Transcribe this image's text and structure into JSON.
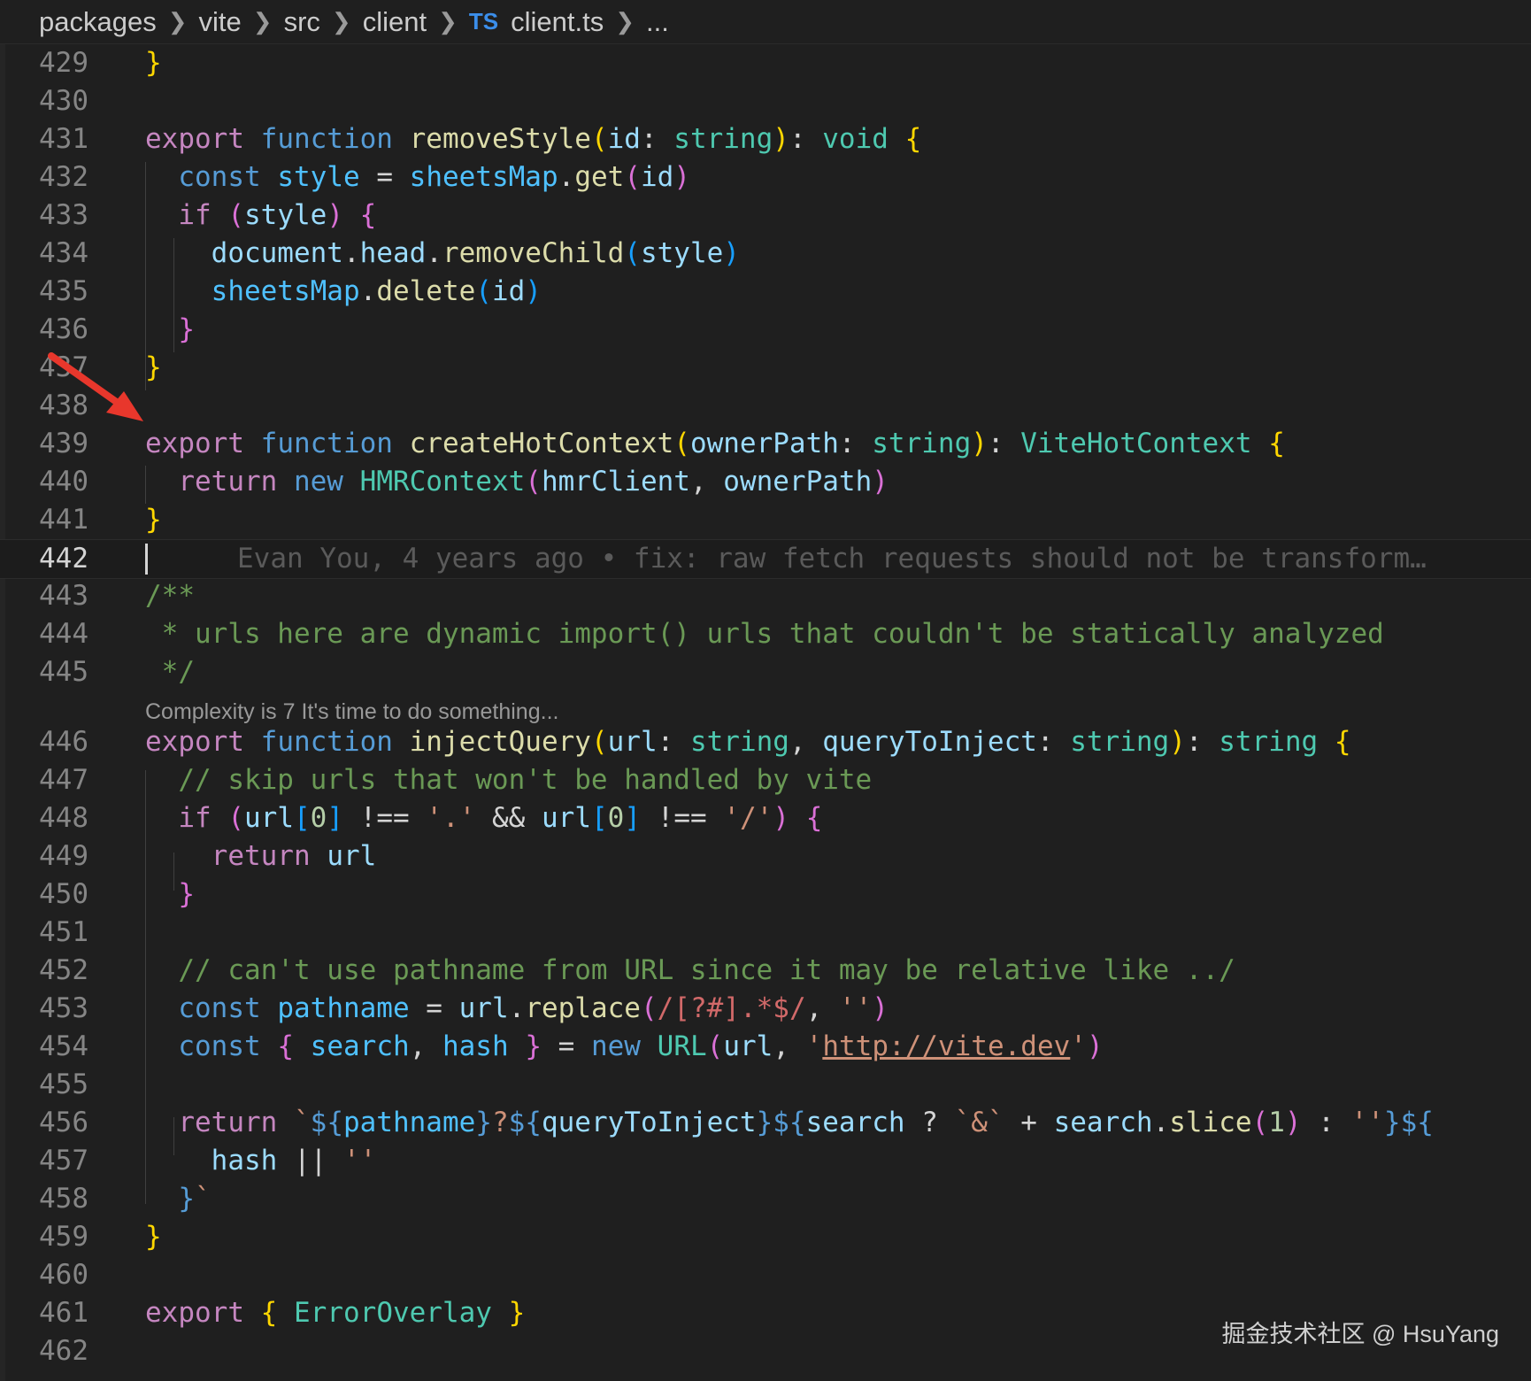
{
  "breadcrumb": {
    "items": [
      "packages",
      "vite",
      "src",
      "client"
    ],
    "file_badge": "TS",
    "file_name": "client.ts",
    "more": "..."
  },
  "lines": [
    {
      "n": "429",
      "tokens": [
        [
          "b1",
          "}"
        ]
      ]
    },
    {
      "n": "430",
      "tokens": []
    },
    {
      "n": "431",
      "tokens": [
        [
          "kw",
          "export"
        ],
        [
          "op",
          " "
        ],
        [
          "st",
          "function"
        ],
        [
          "op",
          " "
        ],
        [
          "fn",
          "removeStyle"
        ],
        [
          "b1",
          "("
        ],
        [
          "vr",
          "id"
        ],
        [
          "op",
          ": "
        ],
        [
          "ty",
          "string"
        ],
        [
          "b1",
          ")"
        ],
        [
          "op",
          ": "
        ],
        [
          "ty",
          "void"
        ],
        [
          "op",
          " "
        ],
        [
          "b1",
          "{"
        ]
      ]
    },
    {
      "n": "432",
      "tokens": [
        [
          "op",
          "  "
        ],
        [
          "st",
          "const"
        ],
        [
          "op",
          " "
        ],
        [
          "cn",
          "style"
        ],
        [
          "op",
          " = "
        ],
        [
          "cn",
          "sheetsMap"
        ],
        [
          "op",
          "."
        ],
        [
          "fn",
          "get"
        ],
        [
          "b2",
          "("
        ],
        [
          "vr",
          "id"
        ],
        [
          "b2",
          ")"
        ]
      ]
    },
    {
      "n": "433",
      "tokens": [
        [
          "op",
          "  "
        ],
        [
          "kw",
          "if"
        ],
        [
          "op",
          " "
        ],
        [
          "b2",
          "("
        ],
        [
          "vr",
          "style"
        ],
        [
          "b2",
          ")"
        ],
        [
          "op",
          " "
        ],
        [
          "b2",
          "{"
        ]
      ]
    },
    {
      "n": "434",
      "tokens": [
        [
          "op",
          "    "
        ],
        [
          "vr",
          "document"
        ],
        [
          "op",
          "."
        ],
        [
          "vr",
          "head"
        ],
        [
          "op",
          "."
        ],
        [
          "fn",
          "removeChild"
        ],
        [
          "b3",
          "("
        ],
        [
          "vr",
          "style"
        ],
        [
          "b3",
          ")"
        ]
      ]
    },
    {
      "n": "435",
      "tokens": [
        [
          "op",
          "    "
        ],
        [
          "cn",
          "sheetsMap"
        ],
        [
          "op",
          "."
        ],
        [
          "fn",
          "delete"
        ],
        [
          "b3",
          "("
        ],
        [
          "vr",
          "id"
        ],
        [
          "b3",
          ")"
        ]
      ]
    },
    {
      "n": "436",
      "tokens": [
        [
          "op",
          "  "
        ],
        [
          "b2",
          "}"
        ]
      ]
    },
    {
      "n": "437",
      "tokens": [
        [
          "b1",
          "}"
        ]
      ]
    },
    {
      "n": "438",
      "tokens": []
    },
    {
      "n": "439",
      "tokens": [
        [
          "kw",
          "export"
        ],
        [
          "op",
          " "
        ],
        [
          "st",
          "function"
        ],
        [
          "op",
          " "
        ],
        [
          "fn",
          "createHotContext"
        ],
        [
          "b1",
          "("
        ],
        [
          "vr",
          "ownerPath"
        ],
        [
          "op",
          ": "
        ],
        [
          "ty",
          "string"
        ],
        [
          "b1",
          ")"
        ],
        [
          "op",
          ": "
        ],
        [
          "ty",
          "ViteHotContext"
        ],
        [
          "op",
          " "
        ],
        [
          "b1",
          "{"
        ]
      ]
    },
    {
      "n": "440",
      "tokens": [
        [
          "op",
          "  "
        ],
        [
          "kw",
          "return"
        ],
        [
          "op",
          " "
        ],
        [
          "st",
          "new"
        ],
        [
          "op",
          " "
        ],
        [
          "ty",
          "HMRContext"
        ],
        [
          "b2",
          "("
        ],
        [
          "vr",
          "hmrClient"
        ],
        [
          "op",
          ", "
        ],
        [
          "vr",
          "ownerPath"
        ],
        [
          "b2",
          ")"
        ]
      ]
    },
    {
      "n": "441",
      "tokens": [
        [
          "b1",
          "}"
        ]
      ]
    },
    {
      "n": "442",
      "tokens": [],
      "current": true,
      "blame": "Evan You, 4 years ago • fix: raw fetch requests should not be transform…"
    },
    {
      "n": "443",
      "tokens": [
        [
          "cm",
          "/**"
        ]
      ]
    },
    {
      "n": "444",
      "tokens": [
        [
          "cm",
          " * urls here are dynamic import() urls that couldn't be statically analyzed"
        ]
      ]
    },
    {
      "n": "445",
      "tokens": [
        [
          "cm",
          " */"
        ]
      ]
    },
    {
      "lens": "Complexity is 7 It's time to do something..."
    },
    {
      "n": "446",
      "tokens": [
        [
          "kw",
          "export"
        ],
        [
          "op",
          " "
        ],
        [
          "st",
          "function"
        ],
        [
          "op",
          " "
        ],
        [
          "fn",
          "injectQuery"
        ],
        [
          "b1",
          "("
        ],
        [
          "vr",
          "url"
        ],
        [
          "op",
          ": "
        ],
        [
          "ty",
          "string"
        ],
        [
          "op",
          ", "
        ],
        [
          "vr",
          "queryToInject"
        ],
        [
          "op",
          ": "
        ],
        [
          "ty",
          "string"
        ],
        [
          "b1",
          ")"
        ],
        [
          "op",
          ": "
        ],
        [
          "ty",
          "string"
        ],
        [
          "op",
          " "
        ],
        [
          "b1",
          "{"
        ]
      ]
    },
    {
      "n": "447",
      "tokens": [
        [
          "op",
          "  "
        ],
        [
          "cm",
          "// skip urls that won't be handled by vite"
        ]
      ]
    },
    {
      "n": "448",
      "tokens": [
        [
          "op",
          "  "
        ],
        [
          "kw",
          "if"
        ],
        [
          "op",
          " "
        ],
        [
          "b2",
          "("
        ],
        [
          "vr",
          "url"
        ],
        [
          "b3",
          "["
        ],
        [
          "nm",
          "0"
        ],
        [
          "b3",
          "]"
        ],
        [
          "op",
          " !== "
        ],
        [
          "s",
          "'.'"
        ],
        [
          "op",
          " && "
        ],
        [
          "vr",
          "url"
        ],
        [
          "b3",
          "["
        ],
        [
          "nm",
          "0"
        ],
        [
          "b3",
          "]"
        ],
        [
          "op",
          " !== "
        ],
        [
          "s",
          "'/'"
        ],
        [
          "b2",
          ")"
        ],
        [
          "op",
          " "
        ],
        [
          "b2",
          "{"
        ]
      ]
    },
    {
      "n": "449",
      "tokens": [
        [
          "op",
          "    "
        ],
        [
          "kw",
          "return"
        ],
        [
          "op",
          " "
        ],
        [
          "vr",
          "url"
        ]
      ]
    },
    {
      "n": "450",
      "tokens": [
        [
          "op",
          "  "
        ],
        [
          "b2",
          "}"
        ]
      ]
    },
    {
      "n": "451",
      "tokens": []
    },
    {
      "n": "452",
      "tokens": [
        [
          "op",
          "  "
        ],
        [
          "cm",
          "// can't use pathname from URL since it may be relative like ../"
        ]
      ]
    },
    {
      "n": "453",
      "tokens": [
        [
          "op",
          "  "
        ],
        [
          "st",
          "const"
        ],
        [
          "op",
          " "
        ],
        [
          "cn",
          "pathname"
        ],
        [
          "op",
          " = "
        ],
        [
          "vr",
          "url"
        ],
        [
          "op",
          "."
        ],
        [
          "fn",
          "replace"
        ],
        [
          "b2",
          "("
        ],
        [
          "rx",
          "/[?#].*$/"
        ],
        [
          "op",
          ", "
        ],
        [
          "s",
          "''"
        ],
        [
          "b2",
          ")"
        ]
      ]
    },
    {
      "n": "454",
      "tokens": [
        [
          "op",
          "  "
        ],
        [
          "st",
          "const"
        ],
        [
          "op",
          " "
        ],
        [
          "b2",
          "{"
        ],
        [
          "op",
          " "
        ],
        [
          "cn",
          "search"
        ],
        [
          "op",
          ", "
        ],
        [
          "cn",
          "hash"
        ],
        [
          "op",
          " "
        ],
        [
          "b2",
          "}"
        ],
        [
          "op",
          " = "
        ],
        [
          "st",
          "new"
        ],
        [
          "op",
          " "
        ],
        [
          "ty",
          "URL"
        ],
        [
          "b2",
          "("
        ],
        [
          "vr",
          "url"
        ],
        [
          "op",
          ", "
        ],
        [
          "s",
          "'"
        ],
        [
          "link",
          "http://vite.dev"
        ],
        [
          "s",
          "'"
        ],
        [
          "b2",
          ")"
        ]
      ]
    },
    {
      "n": "455",
      "tokens": []
    },
    {
      "n": "456",
      "tokens": [
        [
          "op",
          "  "
        ],
        [
          "kw",
          "return"
        ],
        [
          "op",
          " "
        ],
        [
          "s",
          "`"
        ],
        [
          "st",
          "${"
        ],
        [
          "cn",
          "pathname"
        ],
        [
          "st",
          "}"
        ],
        [
          "s",
          "?"
        ],
        [
          "st",
          "${"
        ],
        [
          "vr",
          "queryToInject"
        ],
        [
          "st",
          "}${"
        ],
        [
          "vr",
          "search"
        ],
        [
          "op",
          " ? "
        ],
        [
          "s",
          "`&`"
        ],
        [
          "op",
          " + "
        ],
        [
          "vr",
          "search"
        ],
        [
          "op",
          "."
        ],
        [
          "fn",
          "slice"
        ],
        [
          "b2",
          "("
        ],
        [
          "nm",
          "1"
        ],
        [
          "b2",
          ")"
        ],
        [
          "op",
          " : "
        ],
        [
          "s",
          "''"
        ],
        [
          "st",
          "}${"
        ]
      ]
    },
    {
      "n": "457",
      "tokens": [
        [
          "op",
          "    "
        ],
        [
          "vr",
          "hash"
        ],
        [
          "op",
          " || "
        ],
        [
          "s",
          "''"
        ]
      ]
    },
    {
      "n": "458",
      "tokens": [
        [
          "op",
          "  "
        ],
        [
          "st",
          "}"
        ],
        [
          "s",
          "`"
        ]
      ]
    },
    {
      "n": "459",
      "tokens": [
        [
          "b1",
          "}"
        ]
      ]
    },
    {
      "n": "460",
      "tokens": []
    },
    {
      "n": "461",
      "tokens": [
        [
          "kw",
          "export"
        ],
        [
          "op",
          " "
        ],
        [
          "b1",
          "{"
        ],
        [
          "op",
          " "
        ],
        [
          "ty",
          "ErrorOverlay"
        ],
        [
          "op",
          " "
        ],
        [
          "b1",
          "}"
        ]
      ]
    },
    {
      "n": "462",
      "tokens": []
    }
  ],
  "watermark": "掘金技术社区 @ HsuYang"
}
